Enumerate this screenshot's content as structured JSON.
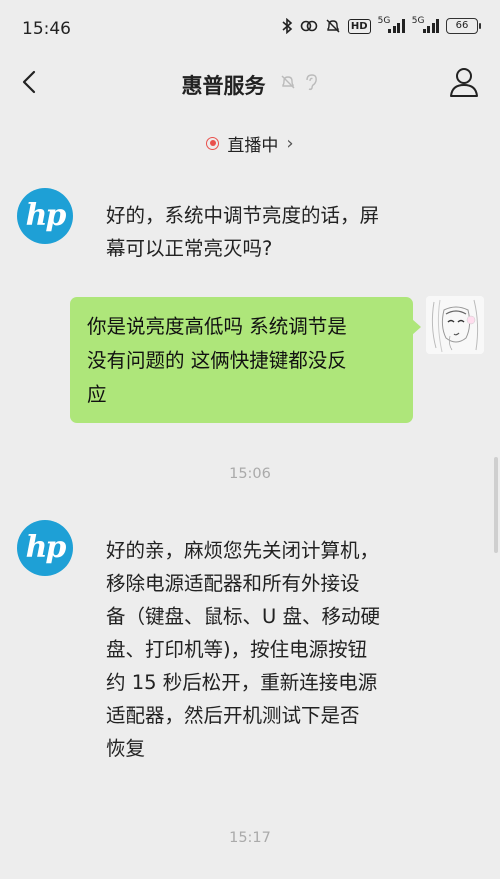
{
  "status_bar": {
    "time": "15:46",
    "hd_label": "HD",
    "net1": "5G",
    "net2": "5G",
    "battery": "66",
    "icons": [
      "bluetooth-icon",
      "link-icon",
      "mute-icon",
      "hd-icon",
      "signal-icon",
      "signal-icon",
      "battery-icon"
    ]
  },
  "header": {
    "title": "惠普服务",
    "icons": [
      "back-icon",
      "bell-off-icon",
      "ear-icon",
      "profile-icon"
    ]
  },
  "live": {
    "label": "直播中",
    "chevron": "›"
  },
  "messages": [
    {
      "sender": "hp",
      "lines": [
        "好的，系统中调节亮度的话，屏",
        "幕可以正常亮灭吗?"
      ]
    },
    {
      "sender": "user",
      "lines": [
        "你是说亮度高低吗 系统调节是",
        "没有问题的 这俩快捷键都没反",
        "应"
      ]
    },
    {
      "timestamp": "15:06"
    },
    {
      "sender": "hp",
      "lines": [
        "好的亲，麻烦您先关闭计算机，",
        "移除电源适配器和所有外接设",
        "备（键盘、鼠标、U 盘、移动硬",
        "盘、打印机等)，按住电源按钮",
        "约 15 秒后松开，重新连接电源",
        "适配器，然后开机测试下是否",
        "恢复"
      ]
    },
    {
      "timestamp": "15:17"
    }
  ],
  "avatars": {
    "hp_logo": "hp"
  },
  "colors": {
    "bubble_out": "#aee67a",
    "hp_blue": "#1ea0d6",
    "live_red": "#e9514d"
  }
}
